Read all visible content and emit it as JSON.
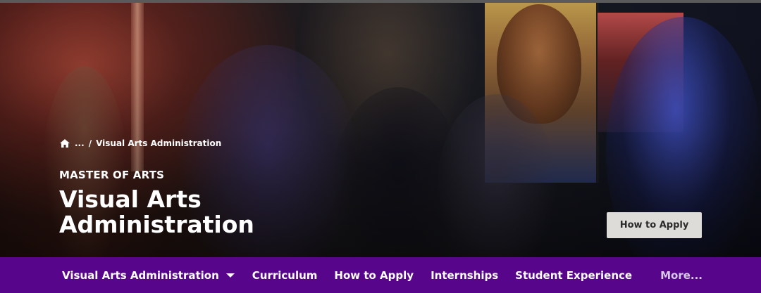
{
  "breadcrumb": {
    "home_icon": "home-icon",
    "ellipsis": "...",
    "separator": "/",
    "current": "Visual Arts Administration"
  },
  "hero": {
    "eyebrow": "MASTER OF ARTS",
    "title": "Visual Arts Administration",
    "cta_label": "How to Apply"
  },
  "nav": {
    "items": [
      {
        "label": "Visual Arts Administration",
        "has_dropdown": true
      },
      {
        "label": "Curriculum"
      },
      {
        "label": "How to Apply"
      },
      {
        "label": "Internships"
      },
      {
        "label": "Student Experience"
      }
    ],
    "more_label": "More..."
  },
  "colors": {
    "nav_background": "#57068c",
    "button_background": "#dedcd8",
    "text": "#ffffff"
  }
}
